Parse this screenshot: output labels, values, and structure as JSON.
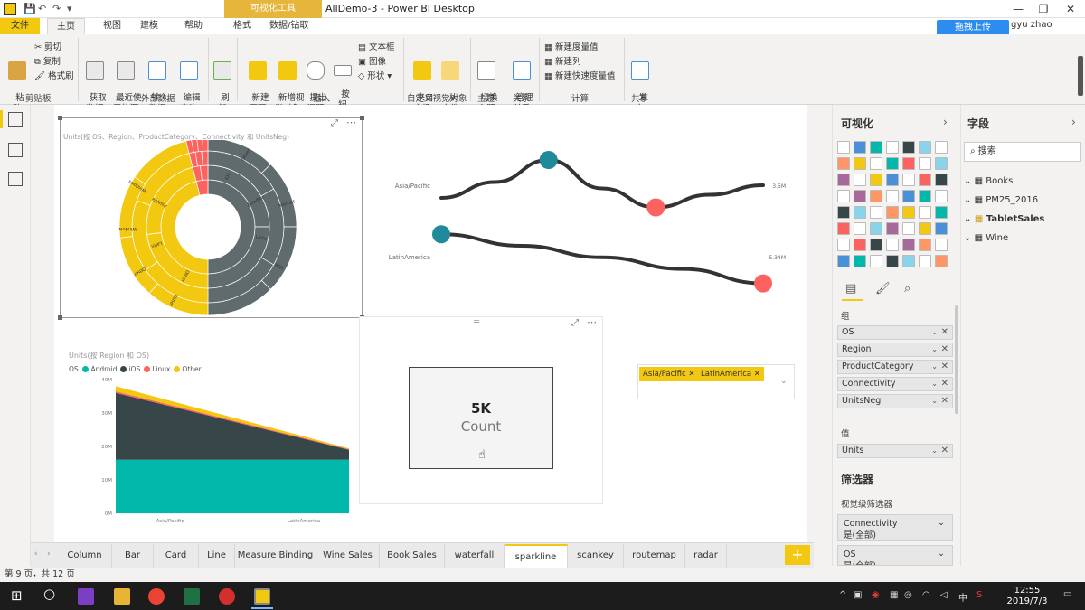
{
  "window": {
    "title": "AllDemo-3 - Power BI Desktop",
    "context_tab": "可视化工具",
    "upload_button": "拖拽上传",
    "username": "gyu zhao",
    "controls": [
      "—",
      "❐",
      "✕"
    ]
  },
  "ribbon_tabs": [
    "文件",
    "主页",
    "视图",
    "建模",
    "帮助",
    "格式",
    "数据/钻取"
  ],
  "ribbon": {
    "clipboard": {
      "paste": "粘\n贴",
      "cut": "剪切",
      "copy": "复制",
      "format_painter": "格式刷",
      "group": "剪贴板"
    },
    "external_data": {
      "get_data": "获取\n数据",
      "recent_sources": "最近使\n用的源",
      "enter_data": "输入\n数据",
      "edit_queries": "编辑\n查询",
      "group": "外部数据"
    },
    "refresh": "刷\n新",
    "insert": {
      "new_page": "新建\n页面",
      "new_visual": "新增视\n觉对象",
      "ask_question": "提出\n问题",
      "buttons": "按\n钮",
      "textbox": "文本框",
      "image": "图像",
      "shapes": "形状",
      "group": "插入"
    },
    "custom_visuals": {
      "from_market": "来自\n市场",
      "from_file": "从\n文件",
      "group": "自定义视觉对象"
    },
    "themes": {
      "switch_theme": "切换\n主题",
      "group": "主题"
    },
    "relationships": {
      "manage": "管理\n关系",
      "group": "关系"
    },
    "calculations": {
      "new_measure": "新建度量值",
      "new_column": "新建列",
      "new_quick_measure": "新建快速度量值",
      "group": "计算"
    },
    "share": {
      "publish": "发\n布",
      "group": "共享"
    }
  },
  "colors": {
    "brand_yellow": "#F2C811",
    "teal": "#01B8AA",
    "dark_gray": "#374649",
    "coral": "#FD625E",
    "sunburst_gray": "#5F6B6D"
  },
  "visuals": {
    "sunburst_title": "Units(按 OS、Region、ProductCategory、Connectivity 和 UnitsNeg)",
    "sunburst_labels": {
      "yellow_outer": [
        "Other",
        "Other",
        "Windows",
        "Windows"
      ],
      "yellow_inner": [
        "Other",
        "Latin",
        "Asia/Pa"
      ],
      "gray_inner": [
        "iOS",
        "Asia/Pac",
        "Latin"
      ],
      "gray_outer": [
        "Other",
        "Internet",
        "WiFi"
      ]
    },
    "sparkline_labels": {
      "row1": "Asia/Pacific",
      "row1_value": "3.5M",
      "row2": "LatinAmerica",
      "row2_value": "5.34M"
    },
    "area_title": "Units(按 Region 和 OS)",
    "area_legend_title": "OS",
    "card": {
      "value": "5K",
      "label": "Count"
    },
    "slicer_chips": [
      "Asia/Pacific",
      "LatinAmerica"
    ]
  },
  "chart_data": [
    {
      "type": "area",
      "title": "Units(按 Region 和 OS)",
      "categories": [
        "Asia/Pacific",
        "LatinAmerica"
      ],
      "y_ticks": [
        "0M",
        "10M",
        "20M",
        "30M",
        "40M"
      ],
      "ylim": [
        0,
        40
      ],
      "stacked": true,
      "legend_title": "OS",
      "series": [
        {
          "name": "Android",
          "values": [
            16,
            16
          ]
        },
        {
          "name": "iOS",
          "values": [
            20,
            3
          ]
        },
        {
          "name": "Linux",
          "values": [
            0.5,
            0.2
          ]
        },
        {
          "name": "Other",
          "values": [
            1.5,
            0.2
          ]
        }
      ],
      "legend_placement": "top-left"
    },
    {
      "type": "line",
      "title": "",
      "rows": [
        {
          "label": "Asia/Pacific",
          "total": "3.5M",
          "points": [
            0.3,
            0.55,
            0.9,
            0.45,
            0.15,
            0.35,
            0.5
          ],
          "high_index": 2,
          "low_index": 4
        },
        {
          "label": "LatinAmerica",
          "total": "5.34M",
          "points": [
            0.95,
            0.75,
            0.55,
            0.35,
            0.1
          ],
          "high_index": 0,
          "low_index": 4
        }
      ]
    },
    {
      "type": "pie",
      "title": "Units(按 OS、Region、ProductCategory、Connectivity 和 UnitsNeg)",
      "series": [
        {
          "name": "iOS",
          "values": [
            50
          ]
        },
        {
          "name": "Other",
          "values": [
            46
          ]
        },
        {
          "name": "Linux",
          "values": [
            4
          ]
        }
      ]
    }
  ],
  "viz_pane": {
    "title": "可视化",
    "sections": {
      "group_label": "组",
      "group_fields": [
        "OS",
        "Region",
        "ProductCategory",
        "Connectivity",
        "UnitsNeg"
      ],
      "value_label": "值",
      "value_fields": [
        "Units"
      ],
      "filters_title": "筛选器",
      "visual_filters_label": "视觉级筛选器",
      "filters": [
        {
          "name": "Connectivity",
          "state": "是(全部)"
        },
        {
          "name": "OS",
          "state": "是(全部)"
        }
      ]
    },
    "icon_colors": [
      "#f2c811",
      "#4a90d9",
      "#01b8aa",
      "#fd625e",
      "#374649",
      "#8ad4eb",
      "#a66999",
      "#fe9666"
    ]
  },
  "fields_pane": {
    "title": "字段",
    "search_placeholder": "搜索",
    "tables": [
      "Books",
      "PM25_2016",
      "TabletSales",
      "Wine"
    ]
  },
  "sheet_tabs": [
    "Column",
    "Bar",
    "Card",
    "Line",
    "Measure Binding",
    "Wine Sales",
    "Book Sales",
    "waterfall",
    "sparkline",
    "scankey",
    "routemap",
    "radar"
  ],
  "active_sheet": "sparkline",
  "status": "第 9 页，共 12 页",
  "taskbar": {
    "time": "12:55",
    "date": "2019/7/3",
    "ime": "中",
    "apps": [
      "windows-start",
      "cortana",
      "visual-studio",
      "explorer",
      "chrome",
      "excel",
      "recorder",
      "powerbi"
    ]
  }
}
